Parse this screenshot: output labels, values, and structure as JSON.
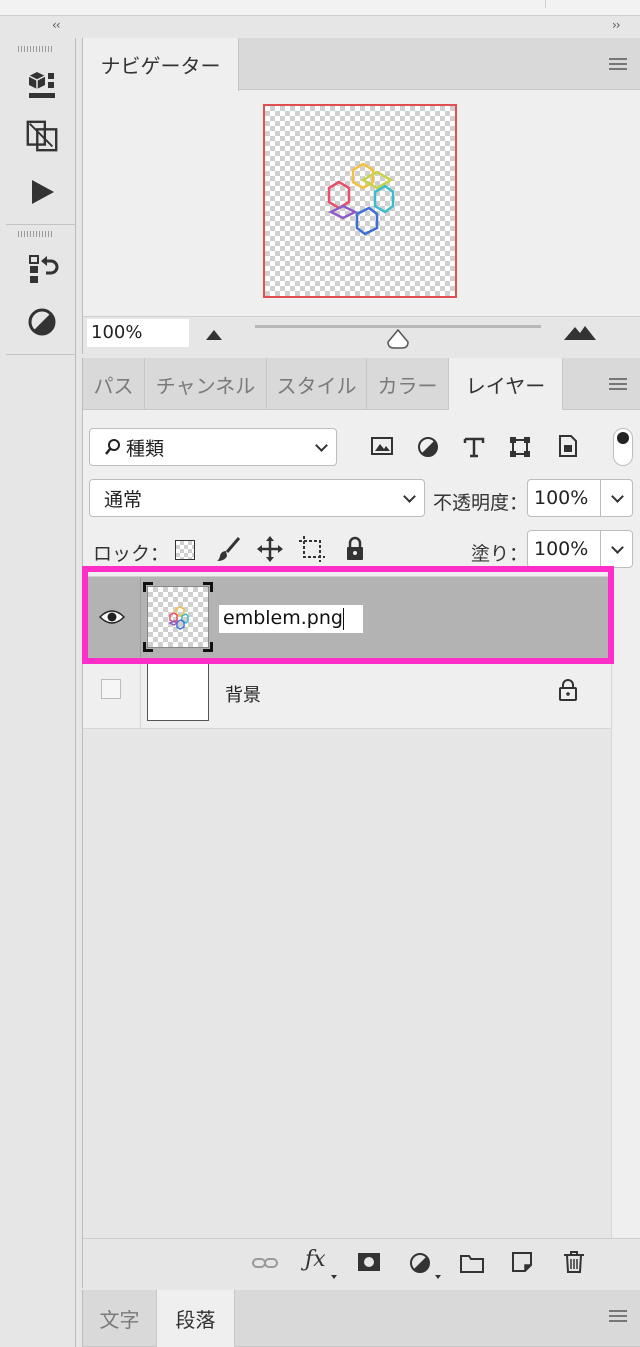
{
  "navigator": {
    "tab_label": "ナビゲーター",
    "zoom_value": "100%",
    "zoom_slider_level": 0.5
  },
  "layers_panel": {
    "tabs": [
      {
        "label": "パス",
        "active": false
      },
      {
        "label": "チャンネル",
        "active": false
      },
      {
        "label": "スタイル",
        "active": false
      },
      {
        "label": "カラー",
        "active": false
      },
      {
        "label": "レイヤー",
        "active": true
      }
    ],
    "filter": {
      "label": "種類"
    },
    "blend_mode": "通常",
    "opacity_label": "不透明度：",
    "opacity_value": "100%",
    "lock_label": "ロック：",
    "fill_label": "塗り：",
    "fill_value": "100%",
    "layers": [
      {
        "name": "emblem.png",
        "visible": true,
        "selected": true,
        "editing": true
      },
      {
        "name": "背景",
        "visible": false,
        "selected": false,
        "locked": true
      }
    ]
  },
  "bottom_panel": {
    "tabs": [
      {
        "label": "文字",
        "active": false
      },
      {
        "label": "段落",
        "active": true
      }
    ]
  },
  "colors": {
    "highlight": "#ff2ec8",
    "nav_frame": "#e05050",
    "selected_layer": "#b3b3b3"
  }
}
